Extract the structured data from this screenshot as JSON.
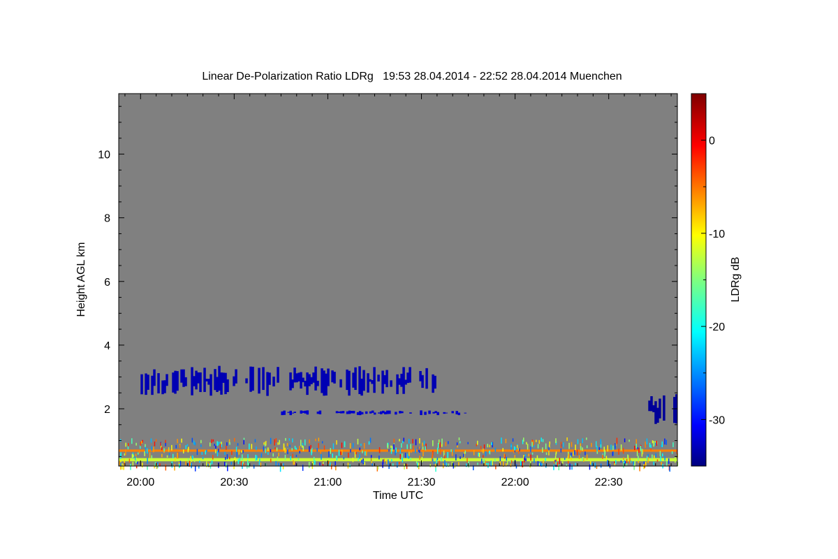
{
  "chart_data": {
    "type": "heatmap",
    "title": "Linear De-Polarization Ratio LDRg   19:53 28.04.2014 - 22:52 28.04.2014 Muenchen",
    "xlabel": "Time UTC",
    "ylabel": "Height AGL km",
    "x_range": [
      "19:53",
      "22:52"
    ],
    "x_ticks": [
      "20:00",
      "20:30",
      "21:00",
      "21:30",
      "22:00",
      "22:30"
    ],
    "ylim": [
      0.2,
      11.9
    ],
    "y_ticks": [
      2,
      4,
      6,
      8,
      10
    ],
    "background_color": "#808080",
    "colorbar": {
      "label": "LDRg dB",
      "range": [
        -35,
        5
      ],
      "ticks": [
        0,
        -10,
        -20,
        -30
      ],
      "colormap": "jet"
    },
    "features": [
      {
        "name": "cloud layer",
        "time": [
          "20:00",
          "21:36"
        ],
        "height_km": [
          2.4,
          3.35
        ],
        "ldr_db": -33
      },
      {
        "name": "thin layer",
        "time": [
          "20:45",
          "21:45"
        ],
        "height_km": [
          1.8,
          1.95
        ],
        "ldr_db": -32
      },
      {
        "name": "late cloud",
        "time": [
          "22:42",
          "22:52"
        ],
        "height_km": [
          1.5,
          2.55
        ],
        "ldr_db": -34
      },
      {
        "name": "near-ground band",
        "time": [
          "19:53",
          "22:52"
        ],
        "height_km": [
          0.65,
          0.72
        ],
        "ldr_db": -5
      },
      {
        "name": "near-ground band",
        "time": [
          "19:53",
          "22:52"
        ],
        "height_km": [
          0.35,
          0.45
        ],
        "ldr_db": -12
      }
    ]
  }
}
